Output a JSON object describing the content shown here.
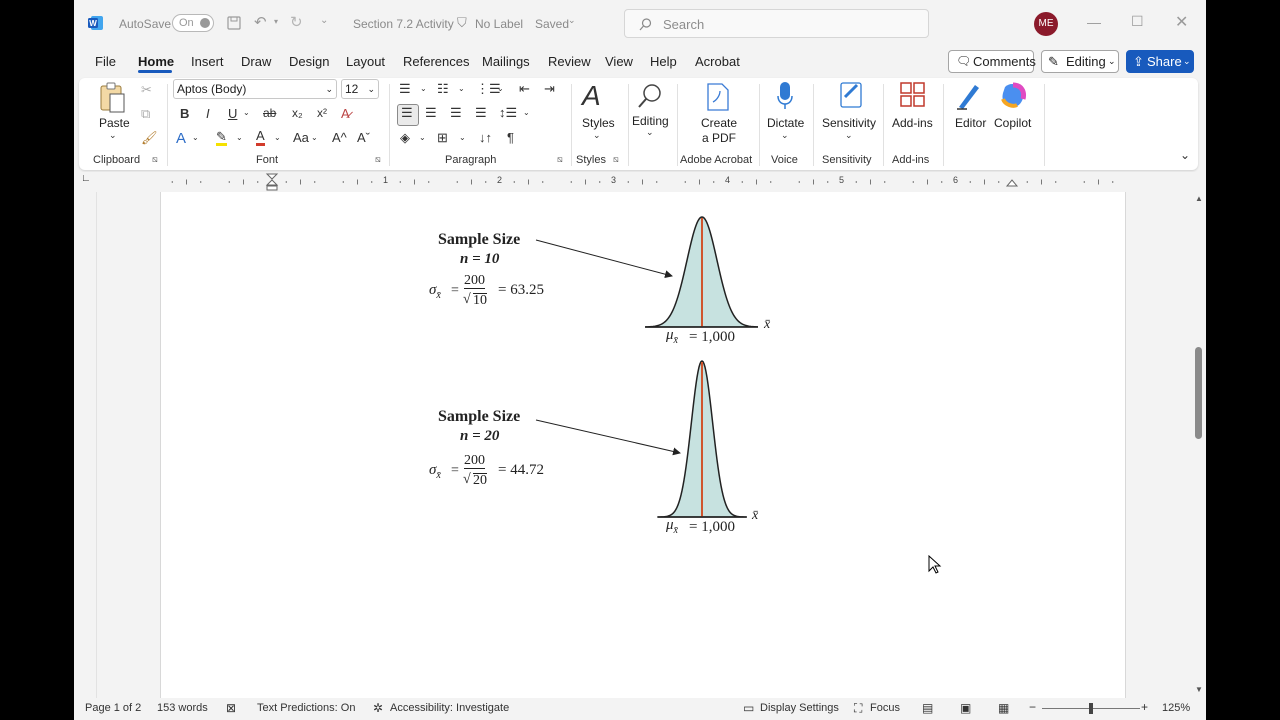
{
  "titlebar": {
    "autosave_label": "AutoSave",
    "autosave_state": "On",
    "doc_title": "Section 7.2 Activity",
    "label_status": "No Label",
    "save_status": "Saved",
    "search_placeholder": "Search",
    "user_initials": "ME"
  },
  "menu": {
    "tabs": [
      "File",
      "Home",
      "Insert",
      "Draw",
      "Design",
      "Layout",
      "References",
      "Mailings",
      "Review",
      "View",
      "Help",
      "Acrobat"
    ],
    "comments": "Comments",
    "editing": "Editing",
    "share": "Share"
  },
  "ribbon": {
    "clipboard": {
      "paste": "Paste",
      "group": "Clipboard"
    },
    "font": {
      "name": "Aptos (Body)",
      "size": "12",
      "group": "Font"
    },
    "paragraph": {
      "group": "Paragraph"
    },
    "styles": {
      "label": "Styles",
      "group": "Styles"
    },
    "editing": {
      "label": "Editing"
    },
    "acrobat": {
      "line1": "Create",
      "line2": "a PDF",
      "group": "Adobe Acrobat"
    },
    "voice": {
      "label": "Dictate",
      "group": "Voice"
    },
    "sensitivity": {
      "label": "Sensitivity",
      "group": "Sensitivity"
    },
    "addins": {
      "label": "Add-ins",
      "group": "Add-ins"
    },
    "editor": {
      "label": "Editor"
    },
    "copilot": {
      "label": "Copilot"
    }
  },
  "ruler": {
    "numbers": [
      "1",
      "2",
      "3",
      "4",
      "5",
      "6"
    ]
  },
  "figure": {
    "top": {
      "title": "Sample Size",
      "n_label": "n = 10",
      "numerator": "200",
      "denominator": "10",
      "result": "= 63.25",
      "mean_label": "= 1,000"
    },
    "bottom": {
      "title": "Sample Size",
      "n_label": "n = 20",
      "numerator": "200",
      "denominator": "20",
      "result": "= 44.72",
      "mean_label": "= 1,000"
    },
    "fill_color": "#c7e2e0",
    "mean_line_color": "#d0552e"
  },
  "status": {
    "page": "Page 1 of 2",
    "words": "153 words",
    "text_predictions": "Text Predictions: On",
    "accessibility": "Accessibility: Investigate",
    "display_settings": "Display Settings",
    "focus": "Focus",
    "zoom": "125%"
  }
}
